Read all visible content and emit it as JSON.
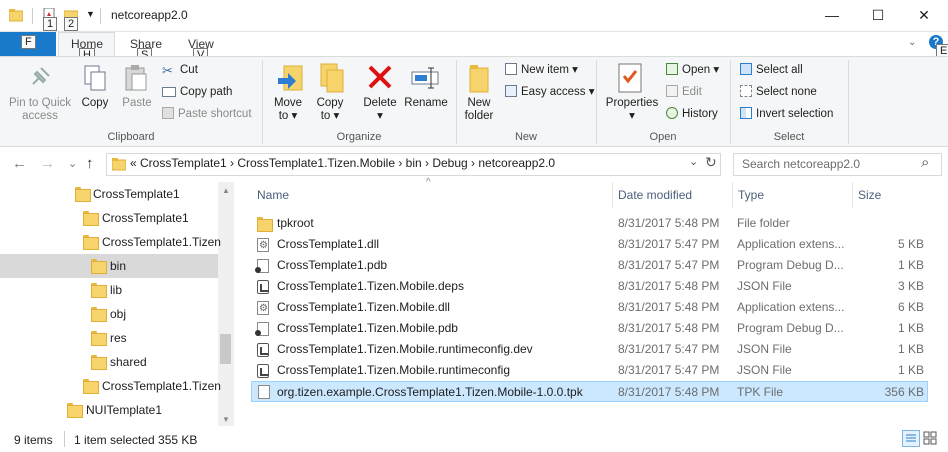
{
  "window": {
    "title": "netcoreapp2.0",
    "qat_keytips": [
      "1",
      "2"
    ],
    "controls": {
      "minimize": "—",
      "maximize": "☐",
      "close": "✕"
    }
  },
  "ribbon": {
    "file_keytip": "F",
    "tabs": [
      {
        "label": "Home",
        "keytip": "H",
        "active": true
      },
      {
        "label": "Share",
        "keytip": "S"
      },
      {
        "label": "View",
        "keytip": "V"
      }
    ],
    "right_keytip": "E",
    "clipboard": {
      "label": "Clipboard",
      "pin_label_1": "Pin to Quick",
      "pin_label_2": "access",
      "copy": "Copy",
      "paste": "Paste",
      "cut": "Cut",
      "copy_path": "Copy path",
      "paste_shortcut": "Paste shortcut"
    },
    "organize": {
      "label": "Organize",
      "move_1": "Move",
      "move_2": "to ▾",
      "copy_1": "Copy",
      "copy_2": "to ▾",
      "delete": "Delete",
      "delete_arrow": "▾",
      "rename": "Rename"
    },
    "new": {
      "label": "New",
      "new_folder_1": "New",
      "new_folder_2": "folder",
      "new_item": "New item ▾",
      "easy_access": "Easy access ▾"
    },
    "open": {
      "label": "Open",
      "properties": "Properties",
      "properties_arrow": "▾",
      "open": "Open ▾",
      "edit": "Edit",
      "history": "History"
    },
    "select": {
      "label": "Select",
      "select_all": "Select all",
      "select_none": "Select none",
      "invert": "Invert selection"
    }
  },
  "nav": {
    "back": "←",
    "forward": "→",
    "recent": "⌄",
    "up": "↑",
    "path": "«  CrossTemplate1  ›  CrossTemplate1.Tizen.Mobile  ›  bin  ›  Debug  ›  netcoreapp2.0",
    "path_dropdown": "⌄",
    "refresh": "↻",
    "search_placeholder": "Search netcoreapp2.0",
    "search_icon": "⌕"
  },
  "tree": [
    {
      "label": "CrossTemplate1",
      "indent": 1
    },
    {
      "label": "CrossTemplate1",
      "indent": 2
    },
    {
      "label": "CrossTemplate1.Tizen",
      "indent": 2
    },
    {
      "label": "bin",
      "indent": 3,
      "selected": true
    },
    {
      "label": "lib",
      "indent": 3
    },
    {
      "label": "obj",
      "indent": 3
    },
    {
      "label": "res",
      "indent": 3
    },
    {
      "label": "shared",
      "indent": 3
    },
    {
      "label": "CrossTemplate1.Tizen",
      "indent": 2
    },
    {
      "label": "NUITemplate1",
      "indent": 1
    }
  ],
  "columns": {
    "name": "Name",
    "date": "Date modified",
    "type": "Type",
    "size": "Size",
    "sort_indicator": "^"
  },
  "files": [
    {
      "name": "tpkroot",
      "date": "8/31/2017 5:48 PM",
      "type": "File folder",
      "size": "",
      "icon": "folder"
    },
    {
      "name": "CrossTemplate1.dll",
      "date": "8/31/2017 5:47 PM",
      "type": "Application extens...",
      "size": "5 KB",
      "icon": "dll"
    },
    {
      "name": "CrossTemplate1.pdb",
      "date": "8/31/2017 5:47 PM",
      "type": "Program Debug D...",
      "size": "1 KB",
      "icon": "pdb"
    },
    {
      "name": "CrossTemplate1.Tizen.Mobile.deps",
      "date": "8/31/2017 5:48 PM",
      "type": "JSON File",
      "size": "3 KB",
      "icon": "json"
    },
    {
      "name": "CrossTemplate1.Tizen.Mobile.dll",
      "date": "8/31/2017 5:48 PM",
      "type": "Application extens...",
      "size": "6 KB",
      "icon": "dll"
    },
    {
      "name": "CrossTemplate1.Tizen.Mobile.pdb",
      "date": "8/31/2017 5:48 PM",
      "type": "Program Debug D...",
      "size": "1 KB",
      "icon": "pdb"
    },
    {
      "name": "CrossTemplate1.Tizen.Mobile.runtimeconfig.dev",
      "date": "8/31/2017 5:47 PM",
      "type": "JSON File",
      "size": "1 KB",
      "icon": "json"
    },
    {
      "name": "CrossTemplate1.Tizen.Mobile.runtimeconfig",
      "date": "8/31/2017 5:47 PM",
      "type": "JSON File",
      "size": "1 KB",
      "icon": "json"
    },
    {
      "name": "org.tizen.example.CrossTemplate1.Tizen.Mobile-1.0.0.tpk",
      "date": "8/31/2017 5:48 PM",
      "type": "TPK File",
      "size": "356 KB",
      "icon": "file",
      "selected": true
    }
  ],
  "status": {
    "items": "9 items",
    "selected": "1 item selected  355 KB"
  },
  "colors": {
    "accent": "#1979ca",
    "selection": "#cce8ff",
    "tree_selection": "#d9d9d9",
    "header_text": "#4c607a"
  }
}
